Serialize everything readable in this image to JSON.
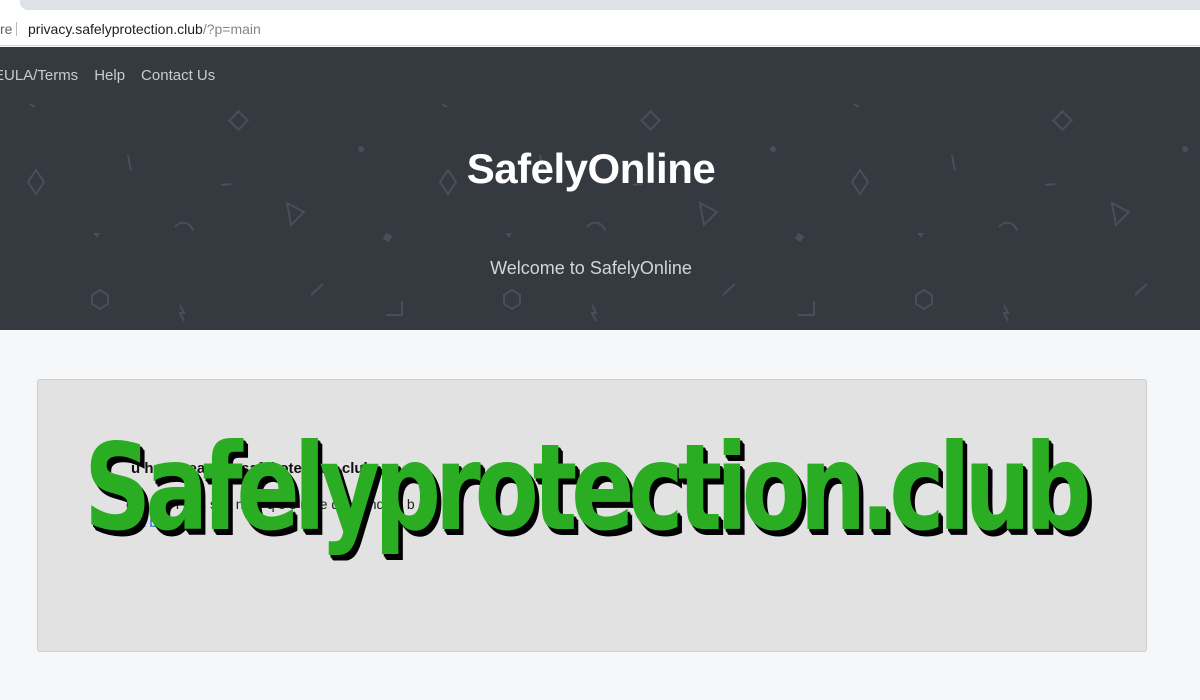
{
  "browser": {
    "address_prefix": "re",
    "url_host": "privacy.safelyprotection.club",
    "url_path": "/?p=main"
  },
  "nav": {
    "items": [
      {
        "label": "EULA/Terms"
      },
      {
        "label": "Help"
      },
      {
        "label": "Contact Us"
      }
    ]
  },
  "hero": {
    "brand": "SafelyOnline",
    "tagline": "Welcome to SafelyOnline",
    "background_color": "#353940"
  },
  "content": {
    "heading": "u have rea    d to safel    otection.club",
    "body_text": "e  o      u      jo      r      ct      s      st      s    n      f       o  q  s  s       n     he     d  s       ct       nd  sh     b     d   s.",
    "link_text": "a     a     b     u    c"
  },
  "overlay": {
    "text": "Safelyprotection.club",
    "color": "#2aad22"
  }
}
